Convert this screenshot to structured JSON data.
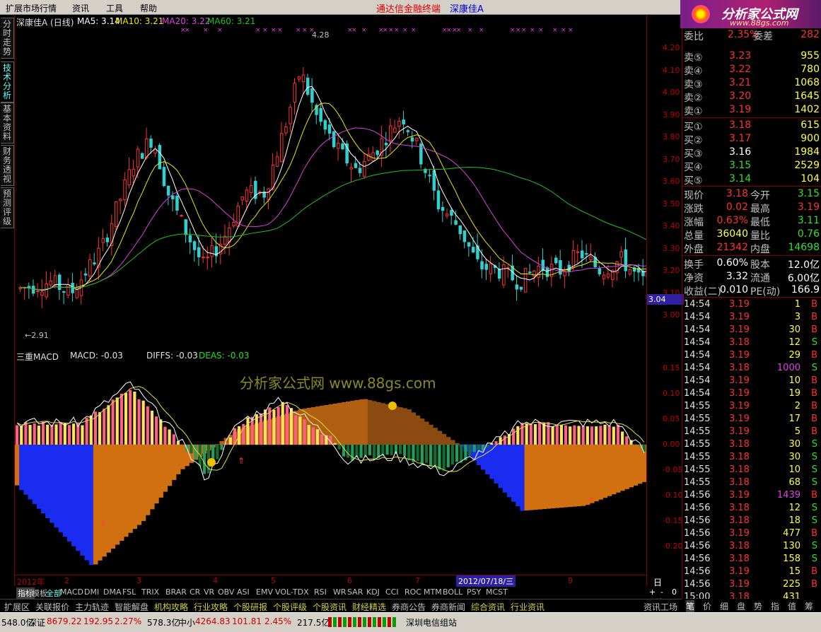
{
  "menu": {
    "items": [
      "扩展市场行情",
      "资讯",
      "工具",
      "帮助"
    ],
    "app_title": "通达信金融终端",
    "stock_title": "深康佳A"
  },
  "logo": {
    "text": "分析家公式网",
    "url": "www.88gs.com"
  },
  "left_tabs": [
    "分时走势",
    "技术分析",
    "基本资料",
    "财务透视",
    "预测评级"
  ],
  "price_panel": {
    "title": "深康佳A (日线)",
    "ma5": "MA5: 3.14",
    "ma10": "MA10: 3.21",
    "ma20": "MA20: 3.22",
    "ma60": "MA60: 3.21",
    "high_label": "4.28",
    "low_label": "2.91",
    "current_tag": "3.04",
    "yticks": [
      "4.20",
      "4.10",
      "4.00",
      "3.90",
      "3.80",
      "3.70",
      "3.60",
      "3.50",
      "3.40",
      "3.30",
      "3.20",
      "3.10",
      "3.00"
    ],
    "colors": {
      "up": "#ff3030",
      "down": "#30d0d0",
      "ma5": "#ffffff",
      "ma10": "#e8e800",
      "ma20": "#e040e0",
      "ma60": "#20c020"
    }
  },
  "macd_panel": {
    "title": "三重MACD",
    "macd": "MACD: -0.03",
    "diffs": "DIFFS: -0.03",
    "deas": "DEAS: -0.03",
    "watermark": "分析家公式网 www.88gs.com",
    "yticks": [
      "0.15",
      "0.10",
      "0.05",
      "0.00",
      "-0.05",
      "-0.10",
      "-0.15",
      "-0.20"
    ]
  },
  "datebar": {
    "labels": [
      "2012年",
      "2",
      "3",
      "4",
      "5",
      "6",
      "7",
      "9"
    ],
    "cursor_date": "2012/07/18/三",
    "period": "日线"
  },
  "quote": {
    "wb": {
      "label1": "委比",
      "val1": "2.35%",
      "label2": "委差",
      "val2": "282"
    },
    "asks": [
      {
        "label": "卖⑤",
        "price": "3.23",
        "vol": "955"
      },
      {
        "label": "卖④",
        "price": "3.22",
        "vol": "780"
      },
      {
        "label": "卖③",
        "price": "3.21",
        "vol": "1068"
      },
      {
        "label": "卖②",
        "price": "3.20",
        "vol": "1645"
      },
      {
        "label": "卖①",
        "price": "3.19",
        "vol": "1402"
      }
    ],
    "bids": [
      {
        "label": "买①",
        "price": "3.18",
        "vol": "615"
      },
      {
        "label": "买②",
        "price": "3.17",
        "vol": "900"
      },
      {
        "label": "买③",
        "price": "3.16",
        "vol": "1984"
      },
      {
        "label": "买④",
        "price": "3.15",
        "vol": "2529"
      },
      {
        "label": "买⑤",
        "price": "3.14",
        "vol": "104"
      }
    ],
    "stats": [
      {
        "l1": "现价",
        "v1": "3.18",
        "l2": "今开",
        "v2": "3.15",
        "c1": "#ff3030",
        "c2": "#30e030"
      },
      {
        "l1": "涨跌",
        "v1": "0.02",
        "l2": "最高",
        "v2": "3.19",
        "c1": "#ff3030",
        "c2": "#ff3030"
      },
      {
        "l1": "涨幅",
        "v1": "0.63%",
        "l2": "最低",
        "v2": "3.11",
        "c1": "#ff3030",
        "c2": "#30e030"
      },
      {
        "l1": "总量",
        "v1": "36040",
        "l2": "量比",
        "v2": "0.76",
        "c1": "#ffff40",
        "c2": "#30e030"
      },
      {
        "l1": "外盘",
        "v1": "21342",
        "l2": "内盘",
        "v2": "14698",
        "c1": "#ff3030",
        "c2": "#30e030"
      }
    ],
    "stats2": [
      {
        "l1": "换手",
        "v1": "0.60%",
        "l2": "股本",
        "v2": "12.0亿"
      },
      {
        "l1": "净资",
        "v1": "3.32",
        "l2": "流通",
        "v2": "6.00亿"
      },
      {
        "l1": "收益(二)",
        "v1": "0.010",
        "l2": "PE(动)",
        "v2": "166.9"
      }
    ],
    "ticks": [
      {
        "t": "14:54",
        "p": "3.19",
        "v": "1",
        "bs": "B"
      },
      {
        "t": "14:54",
        "p": "3.19",
        "v": "3",
        "bs": "B"
      },
      {
        "t": "14:54",
        "p": "3.19",
        "v": "30",
        "bs": "B"
      },
      {
        "t": "14:54",
        "p": "3.18",
        "v": "12",
        "bs": "S"
      },
      {
        "t": "14:54",
        "p": "3.19",
        "v": "29",
        "bs": "B"
      },
      {
        "t": "14:54",
        "p": "3.18",
        "v": "1000",
        "bs": "S"
      },
      {
        "t": "14:54",
        "p": "3.19",
        "v": "10",
        "bs": "B"
      },
      {
        "t": "14:54",
        "p": "3.19",
        "v": "19",
        "bs": "B"
      },
      {
        "t": "14:55",
        "p": "3.19",
        "v": "2",
        "bs": "B"
      },
      {
        "t": "14:55",
        "p": "3.19",
        "v": "17",
        "bs": "B"
      },
      {
        "t": "14:55",
        "p": "3.19",
        "v": "5",
        "bs": "B"
      },
      {
        "t": "14:55",
        "p": "3.18",
        "v": "30",
        "bs": "S"
      },
      {
        "t": "14:55",
        "p": "3.18",
        "v": "30",
        "bs": "S"
      },
      {
        "t": "14:55",
        "p": "3.18",
        "v": "10",
        "bs": "S"
      },
      {
        "t": "14:55",
        "p": "3.18",
        "v": "68",
        "bs": "S"
      },
      {
        "t": "14:56",
        "p": "3.19",
        "v": "1439",
        "bs": "B"
      },
      {
        "t": "14:56",
        "p": "3.18",
        "v": "12",
        "bs": "S"
      },
      {
        "t": "14:56",
        "p": "3.18",
        "v": "18",
        "bs": "S"
      },
      {
        "t": "14:56",
        "p": "3.19",
        "v": "477",
        "bs": "B"
      },
      {
        "t": "14:56",
        "p": "3.18",
        "v": "130",
        "bs": "S"
      },
      {
        "t": "14:56",
        "p": "3.18",
        "v": "158",
        "bs": "S"
      },
      {
        "t": "14:56",
        "p": "3.19",
        "v": "15",
        "bs": "B"
      },
      {
        "t": "14:56",
        "p": "3.19",
        "v": "225",
        "bs": "B"
      },
      {
        "t": "15:00",
        "p": "3.18",
        "v": "431",
        "bs": ""
      }
    ]
  },
  "indicator_tabs": [
    "指标",
    "模板",
    "全部",
    "MACD",
    "DMI",
    "DMA",
    "FSL",
    "TRIX",
    "BRAR",
    "CR",
    "VR",
    "OBV",
    "ASI",
    "EMV",
    "VOL-TDX",
    "RSI",
    "WR",
    "SAR",
    "KDJ",
    "CCI",
    "ROC",
    "MTM",
    "BOLL",
    "PSY",
    "MCST"
  ],
  "zoom": {
    "plus": "+",
    "minus": "-",
    "zero": "0"
  },
  "bottom_tabs": [
    "扩展区",
    "关联报价",
    "主力轨迹",
    "智能解盘",
    "机构攻略",
    "行业攻略",
    "个股研报",
    "个股评级",
    "个股资讯",
    "财经精选",
    "券商公告",
    "券商新闻",
    "综合资讯",
    "行业资讯",
    "资讯工场"
  ],
  "right_tabs": [
    "笔",
    "价",
    "细",
    "盘",
    "势",
    "指",
    "值",
    "筹"
  ],
  "status": {
    "s1": "548.0亿",
    "sz_label": "深证",
    "sz_val": "8679.22",
    "sz_chg": "192.95",
    "sz_pct": "2.27%",
    "s2": "578.3亿",
    "zx_label": "中小",
    "zx_val": "4264.83",
    "zx_chg": "101.81",
    "zx_pct": "2.45%",
    "s3": "217.5亿",
    "server": "深圳电信组站"
  }
}
